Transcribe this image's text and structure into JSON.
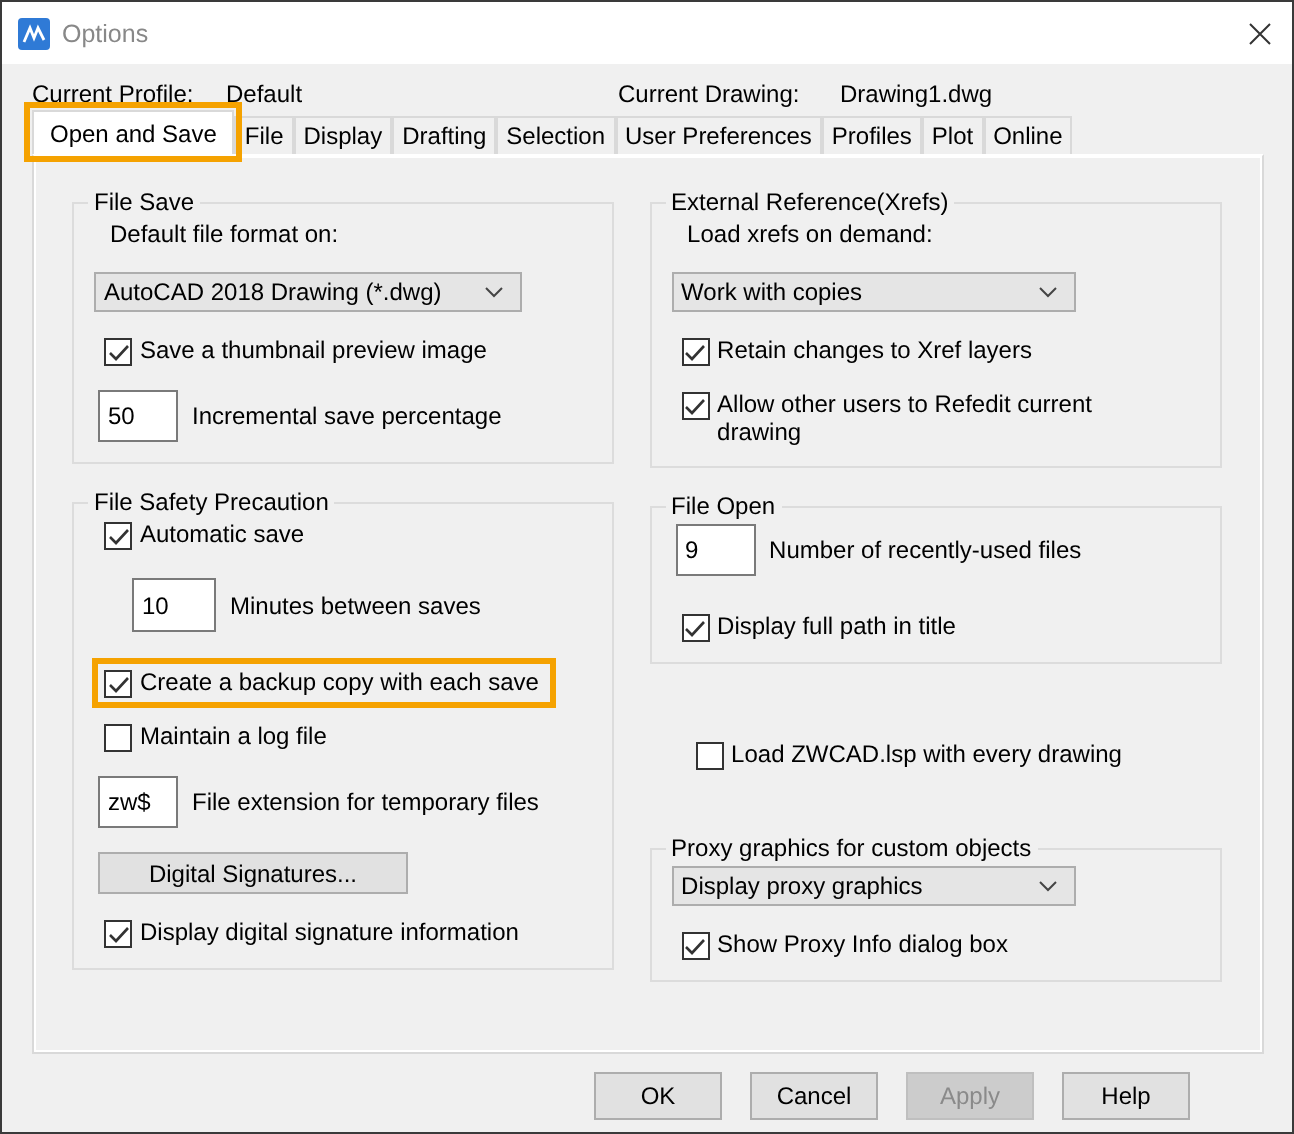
{
  "window": {
    "title": "Options"
  },
  "header": {
    "current_profile_label": "Current Profile:",
    "current_profile": "Default",
    "current_drawing_label": "Current Drawing:",
    "current_drawing": "Drawing1.dwg"
  },
  "tabs": [
    {
      "label": "Open and Save",
      "selected": true,
      "highlighted": true
    },
    {
      "label": "File",
      "selected": false,
      "highlighted": false
    },
    {
      "label": "Display",
      "selected": false,
      "highlighted": false
    },
    {
      "label": "Drafting",
      "selected": false,
      "highlighted": false
    },
    {
      "label": "Selection",
      "selected": false,
      "highlighted": false
    },
    {
      "label": "User Preferences",
      "selected": false,
      "highlighted": false
    },
    {
      "label": "Profiles",
      "selected": false,
      "highlighted": false
    },
    {
      "label": "Plot",
      "selected": false,
      "highlighted": false
    },
    {
      "label": "Online",
      "selected": false,
      "highlighted": false
    }
  ],
  "columns": [
    [
      {
        "kind": "group",
        "title": "File Save",
        "items": [
          {
            "kind": "label",
            "text": "Default file format on:"
          },
          {
            "kind": "dropdown",
            "value": "AutoCAD 2018 Drawing (*.dwg)"
          },
          {
            "kind": "checkbox",
            "label": "Save a thumbnail preview image",
            "checked": true,
            "highlighted": false
          },
          {
            "kind": "field",
            "value": "50",
            "label": "Incremental save percentage"
          }
        ]
      },
      {
        "kind": "group",
        "title": "File Safety Precaution",
        "items": [
          {
            "kind": "checkbox",
            "label": "Automatic save",
            "checked": true,
            "highlighted": false
          },
          {
            "kind": "indented_field",
            "value": "10",
            "label": "Minutes between saves"
          },
          {
            "kind": "checkbox",
            "label": "Create a backup copy with each save",
            "checked": true,
            "highlighted": true
          },
          {
            "kind": "checkbox",
            "label": "Maintain a log file",
            "checked": false,
            "highlighted": false
          },
          {
            "kind": "field",
            "value": "zw$",
            "label": "File extension for temporary files"
          },
          {
            "kind": "button",
            "label": "Digital Signatures..."
          },
          {
            "kind": "checkbox",
            "label": "Display digital signature information",
            "checked": true,
            "highlighted": false
          }
        ]
      }
    ],
    [
      {
        "kind": "group",
        "title": "External Reference(Xrefs)",
        "items": [
          {
            "kind": "label",
            "text": "Load xrefs on demand:"
          },
          {
            "kind": "dropdown",
            "value": "Work with copies"
          },
          {
            "kind": "checkbox",
            "label": "Retain changes to Xref layers",
            "checked": true,
            "highlighted": false
          },
          {
            "kind": "checkbox",
            "label": "Allow other users to Refedit current drawing",
            "checked": true,
            "highlighted": false
          }
        ]
      },
      {
        "kind": "group",
        "title": "File Open",
        "items": [
          {
            "kind": "field",
            "value": "9",
            "label": "Number of recently-used files"
          },
          {
            "kind": "checkbox",
            "label": "Display full path in title",
            "checked": true,
            "highlighted": false
          }
        ]
      },
      {
        "kind": "checkbox",
        "label": "Load ZWCAD.lsp with every drawing",
        "checked": false,
        "highlighted": false
      },
      {
        "kind": "group",
        "title": "Proxy graphics for custom objects",
        "items": [
          {
            "kind": "dropdown",
            "value": "Display proxy graphics"
          },
          {
            "kind": "checkbox",
            "label": "Show Proxy Info dialog box",
            "checked": true,
            "highlighted": false
          }
        ]
      }
    ]
  ],
  "buttons": [
    {
      "label": "OK",
      "disabled": false
    },
    {
      "label": "Cancel",
      "disabled": false
    },
    {
      "label": "Apply",
      "disabled": true
    },
    {
      "label": "Help",
      "disabled": false
    }
  ]
}
